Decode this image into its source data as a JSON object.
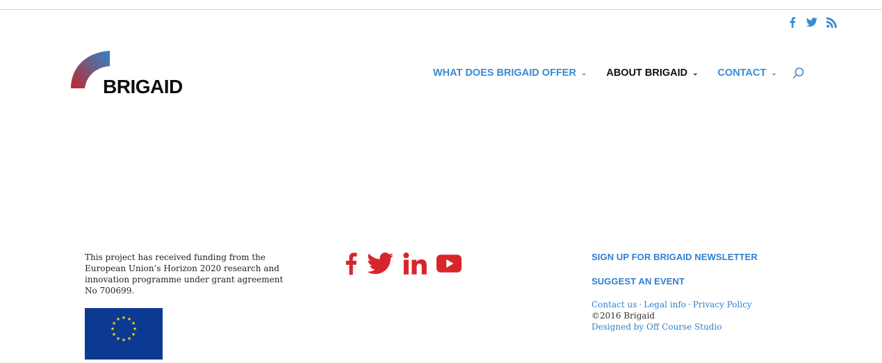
{
  "header": {
    "social": [
      {
        "icon": "facebook-icon",
        "color": "#3a8ad1"
      },
      {
        "icon": "twitter-icon",
        "color": "#3a8ad1"
      },
      {
        "icon": "rss-icon",
        "color": "#3a8ad1"
      }
    ],
    "logo": {
      "text": "BRIGAID",
      "gradient": [
        "#c2272d",
        "#2e86c9"
      ]
    },
    "nav": [
      {
        "label": "WHAT DOES BRIGAID OFFER",
        "color": "#3a8ad1"
      },
      {
        "label": "ABOUT BRIGAID",
        "color": "#111111"
      },
      {
        "label": "CONTACT",
        "color": "#3a8ad1"
      }
    ],
    "search_icon": "search-icon"
  },
  "footer": {
    "funding_text": "This project has received funding from the European Union’s Horizon 2020 research and innovation programme under grant agreement No 700699.",
    "eu_flag": {
      "background": "#0c3a93",
      "stars": "#ffdd00"
    },
    "social": [
      {
        "icon": "facebook-icon",
        "color": "#d7262b"
      },
      {
        "icon": "twitter-icon",
        "color": "#d7262b"
      },
      {
        "icon": "linkedin-icon",
        "color": "#d7262b"
      },
      {
        "icon": "youtube-icon",
        "color": "#d7262b"
      }
    ],
    "newsletter_label": "SIGN UP FOR BRIGAID NEWSLETTER",
    "suggest_label": "SUGGEST AN EVENT",
    "links": {
      "contact": "Contact us",
      "legal": "Legal info",
      "privacy": "Privacy Policy",
      "separator": "·"
    },
    "copyright": "©2016 Brigaid",
    "designed_by": "Designed by Off Course Studio"
  }
}
